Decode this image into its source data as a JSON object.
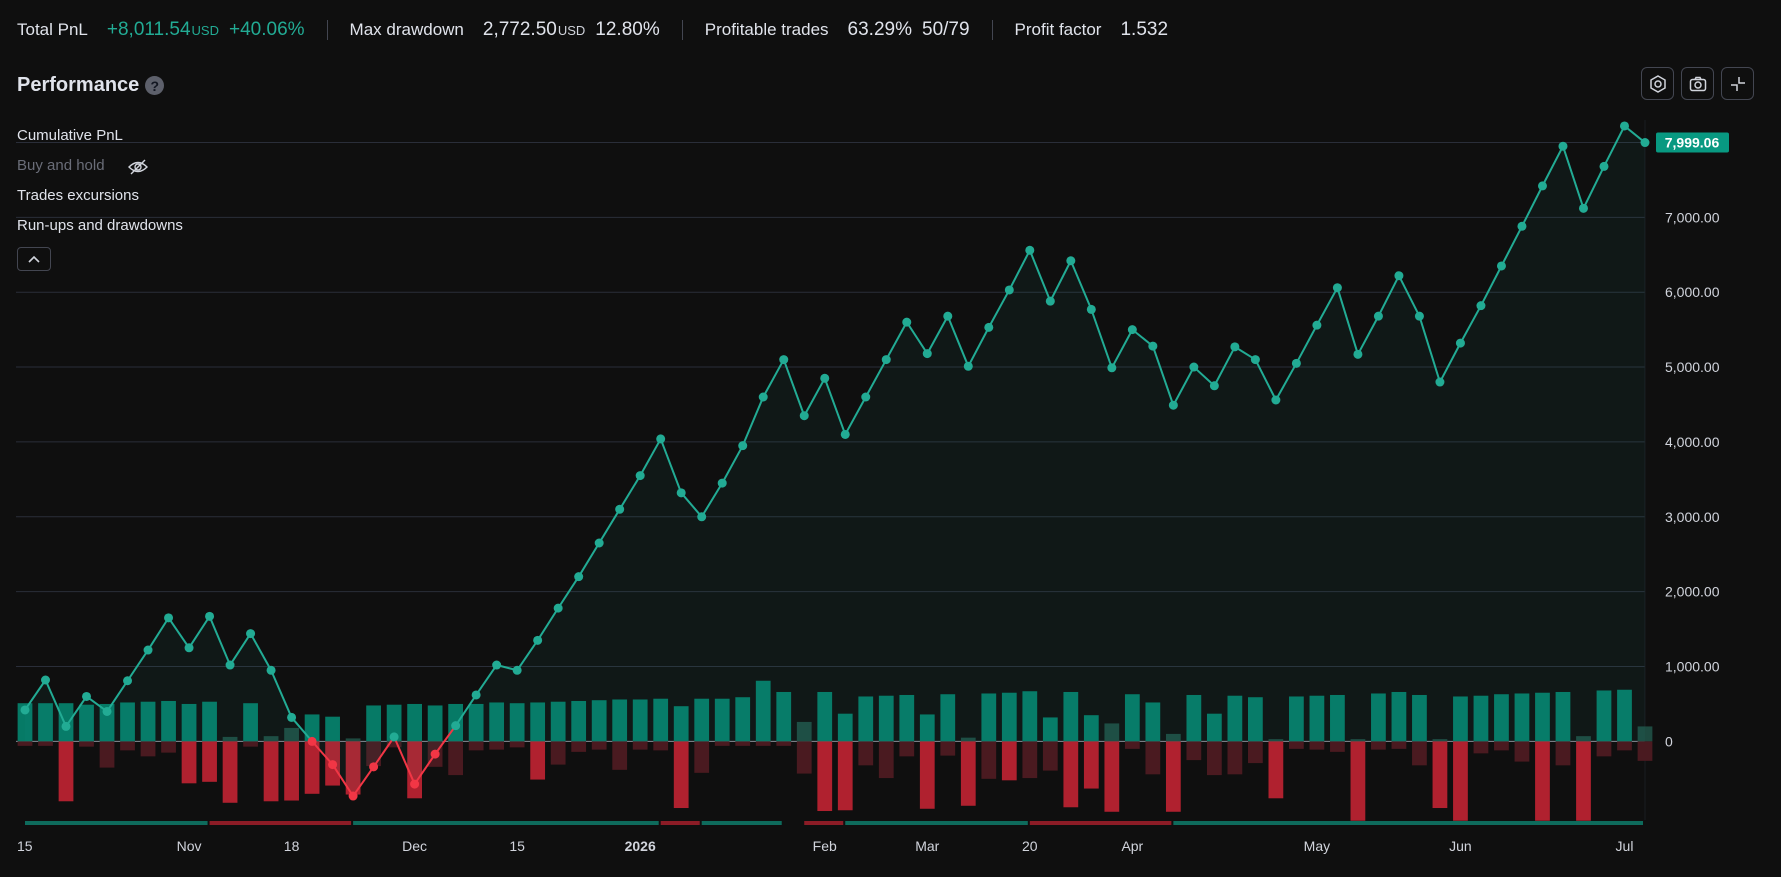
{
  "stats": {
    "total_pnl": {
      "label": "Total PnL",
      "value": "+8,011.54",
      "unit": "USD",
      "pct": "+40.06%"
    },
    "max_drawdown": {
      "label": "Max drawdown",
      "value": "2,772.50",
      "unit": "USD",
      "pct": "12.80%"
    },
    "profitable_trades": {
      "label": "Profitable trades",
      "pct": "63.29%",
      "ratio": "50/79"
    },
    "profit_factor": {
      "label": "Profit factor",
      "value": "1.532"
    }
  },
  "panel": {
    "title": "Performance",
    "help_icon": "?"
  },
  "toolbar": {
    "icons": [
      "settings-icon",
      "camera-icon",
      "collapse-icon"
    ]
  },
  "legend": {
    "cumulative_pnl": "Cumulative PnL",
    "buy_and_hold": "Buy and hold",
    "trades_excursions": "Trades excursions",
    "runups_drawdowns": "Run-ups and drawdowns"
  },
  "colors": {
    "green": "#22ab94",
    "red": "#f23645",
    "green_bar": "#067a66",
    "red_bar": "#b0212f"
  },
  "chart_data": {
    "type": "line",
    "last_value_label": "7,999.06",
    "y_ticks": [
      "7,000.00",
      "6,000.00",
      "5,000.00",
      "4,000.00",
      "3,000.00",
      "2,000.00",
      "1,000.00",
      "0"
    ],
    "y_tick_values": [
      7000,
      6000,
      5000,
      4000,
      3000,
      2000,
      1000,
      0
    ],
    "ylim": [
      -1050,
      8300
    ],
    "x_ticks": [
      {
        "label": "15",
        "index": 0,
        "bold": false
      },
      {
        "label": "Nov",
        "index": 8,
        "bold": false
      },
      {
        "label": "18",
        "index": 13,
        "bold": false
      },
      {
        "label": "Dec",
        "index": 19,
        "bold": false
      },
      {
        "label": "15",
        "index": 24,
        "bold": false
      },
      {
        "label": "2026",
        "index": 30,
        "bold": true
      },
      {
        "label": "Feb",
        "index": 39,
        "bold": false
      },
      {
        "label": "Mar",
        "index": 44,
        "bold": false
      },
      {
        "label": "20",
        "index": 49,
        "bold": false
      },
      {
        "label": "Apr",
        "index": 54,
        "bold": false
      },
      {
        "label": "May",
        "index": 63,
        "bold": false
      },
      {
        "label": "Jun",
        "index": 70,
        "bold": false
      },
      {
        "label": "Jul",
        "index": 78,
        "bold": false
      }
    ],
    "cumulative_pnl": [
      420,
      820,
      200,
      600,
      400,
      810,
      1220,
      1650,
      1250,
      1670,
      1020,
      1440,
      950,
      320,
      0,
      -310,
      -730,
      -340,
      60,
      -570,
      -170,
      210,
      620,
      1020,
      950,
      1350,
      1780,
      2200,
      2650,
      3100,
      3550,
      4040,
      3320,
      3000,
      3450,
      3950,
      4600,
      5100,
      4350,
      4850,
      4100,
      4600,
      5100,
      5600,
      5180,
      5680,
      5010,
      5530,
      6030,
      6560,
      5880,
      6420,
      5770,
      4990,
      5500,
      5280,
      4490,
      5000,
      4750,
      5270,
      5100,
      4560,
      5050,
      5560,
      6060,
      5170,
      5680,
      6220,
      5680,
      4800,
      5320,
      5820,
      6350,
      6880,
      7420,
      7950,
      7120,
      7680,
      8220,
      7999
    ],
    "runups": [
      510,
      510,
      510,
      490,
      500,
      520,
      530,
      540,
      500,
      530,
      60,
      510,
      70,
      180,
      360,
      330,
      40,
      480,
      490,
      500,
      480,
      500,
      500,
      520,
      510,
      520,
      530,
      540,
      550,
      560,
      560,
      570,
      470,
      570,
      570,
      590,
      810,
      660,
      260,
      660,
      370,
      600,
      610,
      620,
      360,
      630,
      50,
      640,
      650,
      670,
      320,
      660,
      350,
      240,
      630,
      520,
      100,
      620,
      370,
      610,
      590,
      30,
      600,
      610,
      620,
      30,
      640,
      660,
      620,
      30,
      600,
      610,
      630,
      640,
      650,
      660,
      70,
      680,
      690,
      200
    ],
    "drawdowns": [
      -60,
      -60,
      -800,
      -70,
      -350,
      -120,
      -200,
      -150,
      -560,
      -540,
      -820,
      -70,
      -800,
      -790,
      -700,
      -590,
      -710,
      -330,
      -80,
      -760,
      -340,
      -450,
      -120,
      -110,
      -80,
      -510,
      -310,
      -140,
      -110,
      -380,
      -110,
      -120,
      -890,
      -420,
      -60,
      -60,
      -60,
      -60,
      -430,
      -930,
      -920,
      -320,
      -490,
      -200,
      -900,
      -190,
      -860,
      -500,
      -520,
      -490,
      -390,
      -880,
      -630,
      -940,
      -100,
      -440,
      -940,
      -250,
      -450,
      -440,
      -290,
      -760,
      -100,
      -110,
      -140,
      -1060,
      -110,
      -100,
      -320,
      -890,
      -1060,
      -160,
      -120,
      -270,
      -1060,
      -320,
      -1060,
      -200,
      -120,
      -260
    ],
    "timeline_segments": [
      {
        "from": 0,
        "to": 9,
        "color": "green"
      },
      {
        "from": 9,
        "to": 16,
        "color": "red"
      },
      {
        "from": 16,
        "to": 31,
        "color": "green"
      },
      {
        "from": 31,
        "to": 33,
        "color": "red"
      },
      {
        "from": 33,
        "to": 37,
        "color": "green"
      },
      {
        "from": 38,
        "to": 40,
        "color": "red"
      },
      {
        "from": 40,
        "to": 49,
        "color": "green"
      },
      {
        "from": 49,
        "to": 56,
        "color": "red"
      },
      {
        "from": 56,
        "to": 79,
        "color": "green"
      }
    ]
  }
}
